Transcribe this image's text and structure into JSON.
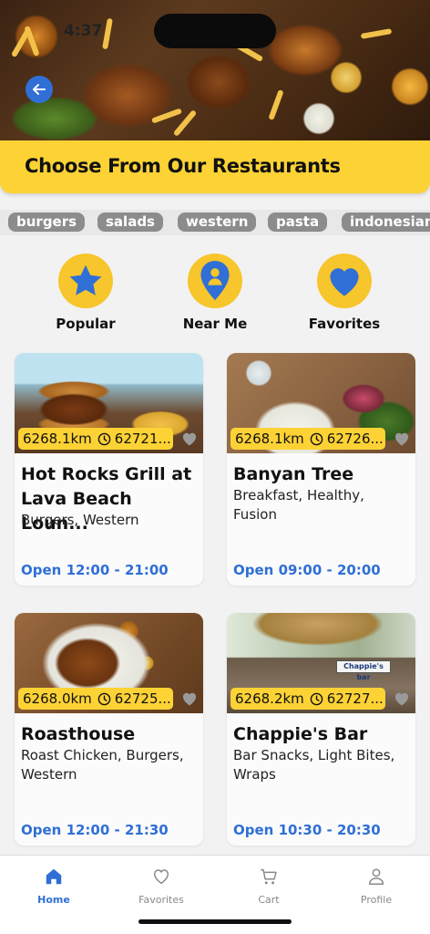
{
  "status_bar": {
    "time": "4:37"
  },
  "header": {
    "title": "Choose From Our Restaurants"
  },
  "categories": [
    "burgers",
    "salads",
    "western",
    "pasta",
    "indonesian"
  ],
  "quick_links": [
    {
      "label": "Popular",
      "icon": "star-icon"
    },
    {
      "label": "Near Me",
      "icon": "location-person-icon"
    },
    {
      "label": "Favorites",
      "icon": "heart-icon"
    }
  ],
  "restaurants": [
    {
      "distance": "6268.1km",
      "time": "62721...",
      "name": "Hot Rocks Grill at Lava Beach Loun...",
      "cuisine": "Burgers, Western",
      "hours": "Open 12:00 - 21:00"
    },
    {
      "distance": "6268.1km",
      "time": "62726...",
      "name": "Banyan Tree",
      "cuisine": "Breakfast, Healthy, Fusion",
      "hours": "Open 09:00 - 20:00"
    },
    {
      "distance": "6268.0km",
      "time": "62725...",
      "name": "Roasthouse",
      "cuisine": "Roast Chicken, Burgers, Western",
      "hours": "Open 12:00 - 21:30"
    },
    {
      "distance": "6268.2km",
      "time": "62727...",
      "name": "Chappie's Bar",
      "cuisine": "Bar Snacks, Light Bites, Wraps",
      "hours": "Open 10:30 - 20:30"
    }
  ],
  "photo_sign_text": "Chappie's bar",
  "bottom_nav": [
    {
      "label": "Home",
      "icon": "home-icon",
      "active": true
    },
    {
      "label": "Favorites",
      "icon": "heart-outline-icon",
      "active": false
    },
    {
      "label": "Cart",
      "icon": "cart-icon",
      "active": false
    },
    {
      "label": "Profile",
      "icon": "person-icon",
      "active": false
    }
  ],
  "colors": {
    "accent": "#fdd235",
    "primary": "#2f6fd6",
    "chip": "#8c8c8c",
    "icon_circle": "#f7c52c"
  }
}
